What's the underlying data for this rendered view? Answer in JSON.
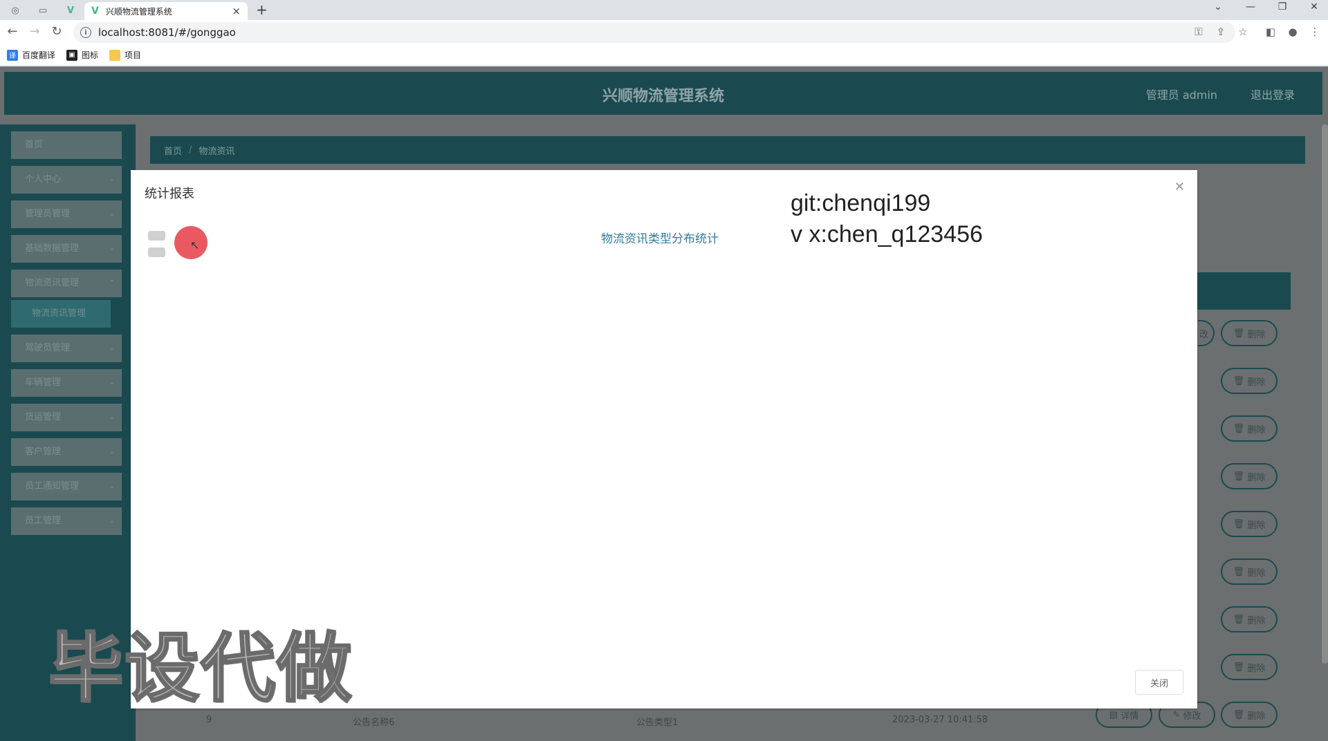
{
  "browser": {
    "tab_title": "兴顺物流管理系统",
    "url": "localhost:8081/#/gonggao",
    "bookmarks": [
      "百度翻译",
      "图标",
      "项目"
    ]
  },
  "app": {
    "title": "兴顺物流管理系统",
    "user": "管理员 admin",
    "logout": "退出登录"
  },
  "sidebar": {
    "items": [
      {
        "label": "首页"
      },
      {
        "label": "个人中心"
      },
      {
        "label": "管理员管理"
      },
      {
        "label": "基础数据管理"
      },
      {
        "label": "物流资讯管理"
      },
      {
        "label": "驾驶员管理"
      },
      {
        "label": "车辆管理"
      },
      {
        "label": "货运管理"
      },
      {
        "label": "客户管理"
      },
      {
        "label": "员工通知管理"
      },
      {
        "label": "员工管理"
      }
    ],
    "sub_item": "物流资讯管理"
  },
  "breadcrumb": {
    "home": "首页",
    "current": "物流资讯"
  },
  "table": {
    "row_buttons": {
      "detail": "详情",
      "edit": "修改",
      "delete": "删除"
    },
    "last_row": {
      "index": "9",
      "name": "公告名称6",
      "type": "公告类型1",
      "time": "2023-03-27 10:41:58"
    }
  },
  "modal": {
    "title": "统计报表",
    "chart_title": "物流资讯类型分布统计",
    "close_label": "关闭"
  },
  "overlay": {
    "line1": "git:chenqi199",
    "line2": "v x:chen_q123456",
    "big_text": "毕设代做"
  }
}
